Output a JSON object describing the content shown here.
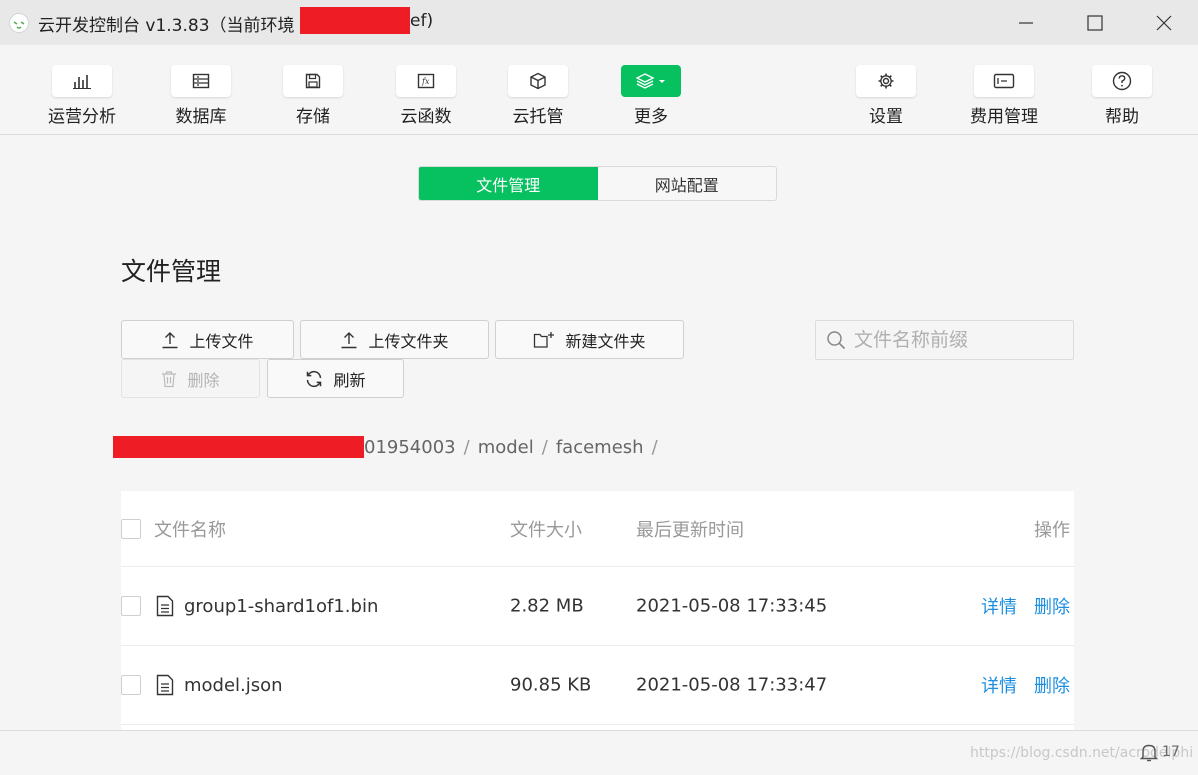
{
  "window": {
    "title": "云开发控制台 v1.3.83（当前环境",
    "title_suffix": "ef)"
  },
  "toolbar": {
    "items": [
      {
        "label": "运营分析",
        "icon": "bar-chart-icon"
      },
      {
        "label": "数据库",
        "icon": "database-icon"
      },
      {
        "label": "存储",
        "icon": "storage-icon"
      },
      {
        "label": "云函数",
        "icon": "function-icon"
      },
      {
        "label": "云托管",
        "icon": "cube-icon"
      },
      {
        "label": "更多",
        "icon": "layers-icon"
      },
      {
        "label": "设置",
        "icon": "gear-icon"
      },
      {
        "label": "费用管理",
        "icon": "billing-icon"
      },
      {
        "label": "帮助",
        "icon": "help-icon"
      }
    ]
  },
  "tabs": {
    "file_manage": "文件管理",
    "site_config": "网站配置"
  },
  "page": {
    "title": "文件管理"
  },
  "actions": {
    "upload_file": "上传文件",
    "upload_folder": "上传文件夹",
    "new_folder": "新建文件夹",
    "delete": "删除",
    "refresh": "刷新"
  },
  "search": {
    "placeholder": "文件名称前缀"
  },
  "breadcrumb": {
    "items": [
      "01954003",
      "model",
      "facemesh"
    ],
    "separator": "/"
  },
  "table": {
    "headers": {
      "name": "文件名称",
      "size": "文件大小",
      "updated": "最后更新时间",
      "ops": "操作"
    },
    "rows": [
      {
        "name": "group1-shard1of1.bin",
        "size": "2.82 MB",
        "updated": "2021-05-08 17:33:45",
        "detail": "详情",
        "delete": "删除"
      },
      {
        "name": "model.json",
        "size": "90.85 KB",
        "updated": "2021-05-08 17:33:47",
        "detail": "详情",
        "delete": "删除"
      }
    ]
  },
  "status": {
    "watermark": "https://blog.csdn.net/acrodelphi",
    "notifications": "17"
  },
  "colors": {
    "accent": "#07c160",
    "link": "#1d8fe0",
    "redaction": "#ee1c25"
  }
}
